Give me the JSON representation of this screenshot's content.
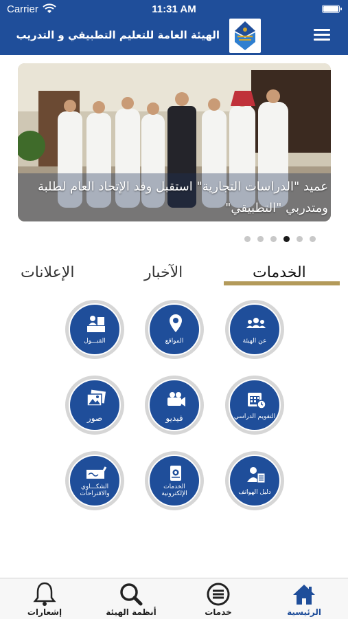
{
  "status_bar": {
    "carrier": "Carrier",
    "time": "11:31 AM"
  },
  "header": {
    "title": "الهيئة العامة للتعليم التطبيقي و التدريب",
    "logo": "paaet-logo",
    "menu_icon": "hamburger-icon"
  },
  "carousel": {
    "caption_line1": "عميد \"الدراسات التجارية\" استقبل وفد الإتحاد العام لطلبة",
    "caption_line2": "ومتدربي \"التطبيقي\"",
    "slide_count": 6,
    "active_index": 4
  },
  "tabs": {
    "services": "الخدمات",
    "news": "الآخبار",
    "ads": "الإعلانات",
    "active": "services"
  },
  "services": [
    {
      "label": "عن الهيئة",
      "icon": "group-icon"
    },
    {
      "label": "المواقع",
      "icon": "location-pin-icon"
    },
    {
      "label": "القبـــول",
      "icon": "admission-desk-icon"
    },
    {
      "label": "التقويم الدراسي",
      "icon": "calendar-icon"
    },
    {
      "label": "فيديو",
      "icon": "video-camera-icon"
    },
    {
      "label": "صور",
      "icon": "photos-icon"
    },
    {
      "label": "دليل الهواتف",
      "icon": "phone-directory-icon"
    },
    {
      "label": "الخدمات الإلكترونية",
      "icon": "e-services-icon"
    },
    {
      "label": "الشكـــاوي والاقتراحات",
      "icon": "complaints-icon"
    }
  ],
  "tabbar": [
    {
      "label": "الرئيسية",
      "icon": "home-icon",
      "active": true
    },
    {
      "label": "خدمات",
      "icon": "list-circle-icon",
      "active": false
    },
    {
      "label": "أنظمة الهيئة",
      "icon": "search-icon",
      "active": false
    },
    {
      "label": "إشعارات",
      "icon": "bell-icon",
      "active": false
    }
  ],
  "colors": {
    "primary": "#1f4e9a",
    "accent": "#b39a5a",
    "ring": "#d6d6d6"
  }
}
